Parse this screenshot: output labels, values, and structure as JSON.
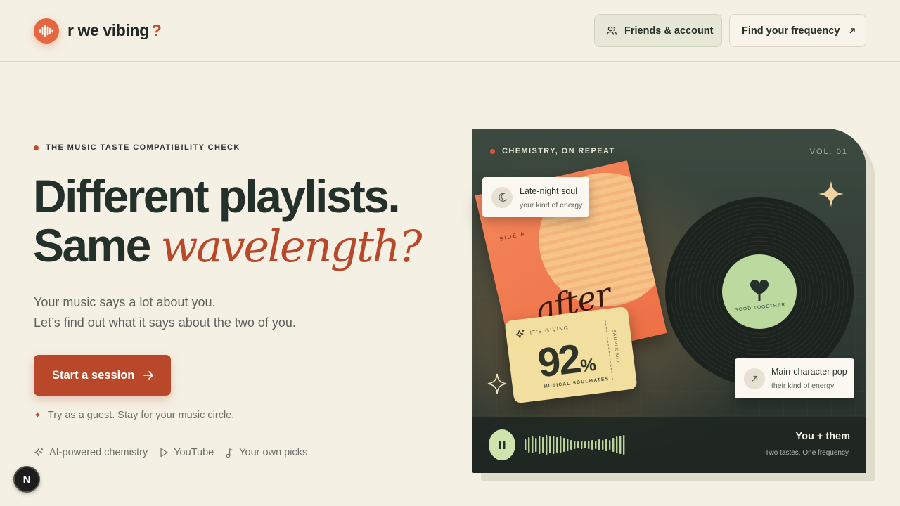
{
  "header": {
    "logo_text": "r we vibing",
    "logo_q": "?",
    "friends_label": "Friends & account",
    "freq_label": "Find your frequency"
  },
  "hero": {
    "eyebrow": "THE MUSIC TASTE COMPATIBILITY CHECK",
    "title_line1": "Different playlists.",
    "title_line2_a": "Same",
    "title_line2_b": "wavelength?",
    "sub_line1": "Your music says a lot about you.",
    "sub_line2": "Let’s find out what it says about the two of you.",
    "cta": "Start a session",
    "guest_note": "Try as a guest. Stay for your music circle.",
    "features": [
      "AI-powered chemistry",
      "YouTube",
      "Your own picks"
    ]
  },
  "card": {
    "eyebrow": "CHEMISTRY, ON REPEAT",
    "vol": "VOL. 01",
    "album_side": "SIDE A",
    "album_word": "after",
    "pill_top": {
      "title": "Late-night soul",
      "sub": "your kind of energy"
    },
    "pill_bottom": {
      "title": "Main-character pop",
      "sub": "their kind of energy"
    },
    "ticket": {
      "giving": "IT'S GIVING",
      "percent_num": "92",
      "percent_sign": "%",
      "caption": "MUSICAL SOULMATES",
      "side": "SAMPLE MIX"
    },
    "vinyl_label": "GOOD TOGETHER",
    "player_title": "You + them",
    "player_tagline": "Two tastes. One frequency."
  },
  "badge": "N",
  "colors": {
    "accent": "#b9472a",
    "logo": "#e5663f",
    "bg": "#f5f0e4",
    "card": "#2f3a32",
    "play": "#cfe3ae"
  }
}
